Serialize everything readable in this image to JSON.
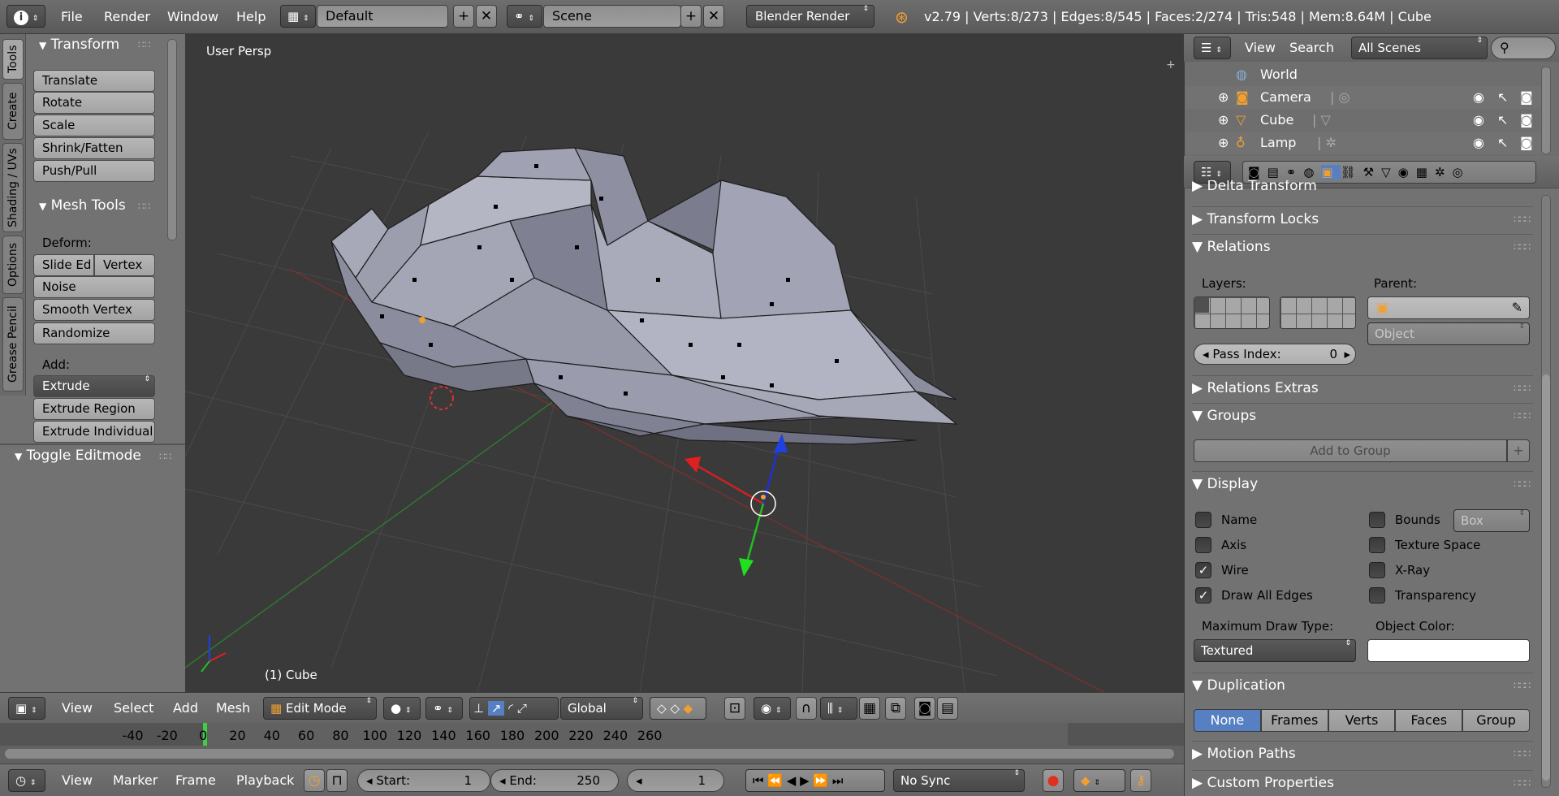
{
  "topbar": {
    "menus": [
      "File",
      "Render",
      "Window",
      "Help"
    ],
    "layout": "Default",
    "scene": "Scene",
    "engine": "Blender Render",
    "stats": "v2.79 | Verts:8/273 | Edges:8/545 | Faces:2/274 | Tris:548 | Mem:8.64M | Cube"
  },
  "shelf": {
    "tabs": [
      "Tools",
      "Create",
      "Shading / UVs",
      "Options",
      "Grease Pencil"
    ],
    "transform": {
      "title": "Transform",
      "buttons": [
        "Translate",
        "Rotate",
        "Scale",
        "Shrink/Fatten",
        "Push/Pull"
      ]
    },
    "mesh_tools": {
      "title": "Mesh Tools",
      "deform_label": "Deform:",
      "slide_edge": "Slide Ed",
      "vertex": "Vertex",
      "buttons": [
        "Noise",
        "Smooth Vertex",
        "Randomize"
      ],
      "add_label": "Add:",
      "extrude": "Extrude",
      "extrude_region": "Extrude Region",
      "extrude_individual": "Extrude Individual"
    },
    "toggle_editmode": "Toggle Editmode"
  },
  "viewport": {
    "view_label": "User Persp",
    "object_label": "(1) Cube"
  },
  "viewport_header": {
    "menus": [
      "View",
      "Select",
      "Add",
      "Mesh"
    ],
    "mode": "Edit Mode",
    "orientation": "Global"
  },
  "timeline": {
    "ticks": [
      "-40",
      "-20",
      "0",
      "20",
      "40",
      "60",
      "80",
      "100",
      "120",
      "140",
      "160",
      "180",
      "200",
      "220",
      "240",
      "260"
    ],
    "current_frame_marker": 1
  },
  "timeline_header": {
    "menus": [
      "View",
      "Marker",
      "Frame",
      "Playback"
    ],
    "start_label": "Start:",
    "start_value": "1",
    "end_label": "End:",
    "end_value": "250",
    "current_value": "1",
    "sync": "No Sync"
  },
  "outliner": {
    "view": "View",
    "search": "Search",
    "filter": "All Scenes",
    "items": [
      "World",
      "Camera",
      "Cube",
      "Lamp"
    ]
  },
  "properties": {
    "delta_transform": "Delta Transform",
    "transform_locks": "Transform Locks",
    "relations": {
      "title": "Relations",
      "layers_label": "Layers:",
      "parent_label": "Parent:",
      "parent_type": "Object",
      "pass_index_label": "Pass Index:",
      "pass_index_value": "0"
    },
    "relations_extras": "Relations Extras",
    "groups": {
      "title": "Groups",
      "add_to_group": "Add to Group"
    },
    "display": {
      "title": "Display",
      "left_checks": [
        {
          "label": "Name",
          "checked": false
        },
        {
          "label": "Axis",
          "checked": false
        },
        {
          "label": "Wire",
          "checked": true
        },
        {
          "label": "Draw All Edges",
          "checked": true
        }
      ],
      "right_checks": [
        {
          "label": "Bounds",
          "checked": false
        },
        {
          "label": "Texture Space",
          "checked": false
        },
        {
          "label": "X-Ray",
          "checked": false
        },
        {
          "label": "Transparency",
          "checked": false
        }
      ],
      "bounds_type": "Box",
      "max_draw_type_label": "Maximum Draw Type:",
      "max_draw_type": "Textured",
      "object_color_label": "Object Color:",
      "object_color": "#ffffff"
    },
    "duplication": {
      "title": "Duplication",
      "options": [
        "None",
        "Frames",
        "Verts",
        "Faces",
        "Group"
      ],
      "selected": "None"
    },
    "motion_paths": "Motion Paths",
    "custom_properties": "Custom Properties"
  },
  "colors": {
    "accent": "#5680c2",
    "viewport_bg": "#3a3a3a",
    "mesh": "#a8aabb"
  }
}
